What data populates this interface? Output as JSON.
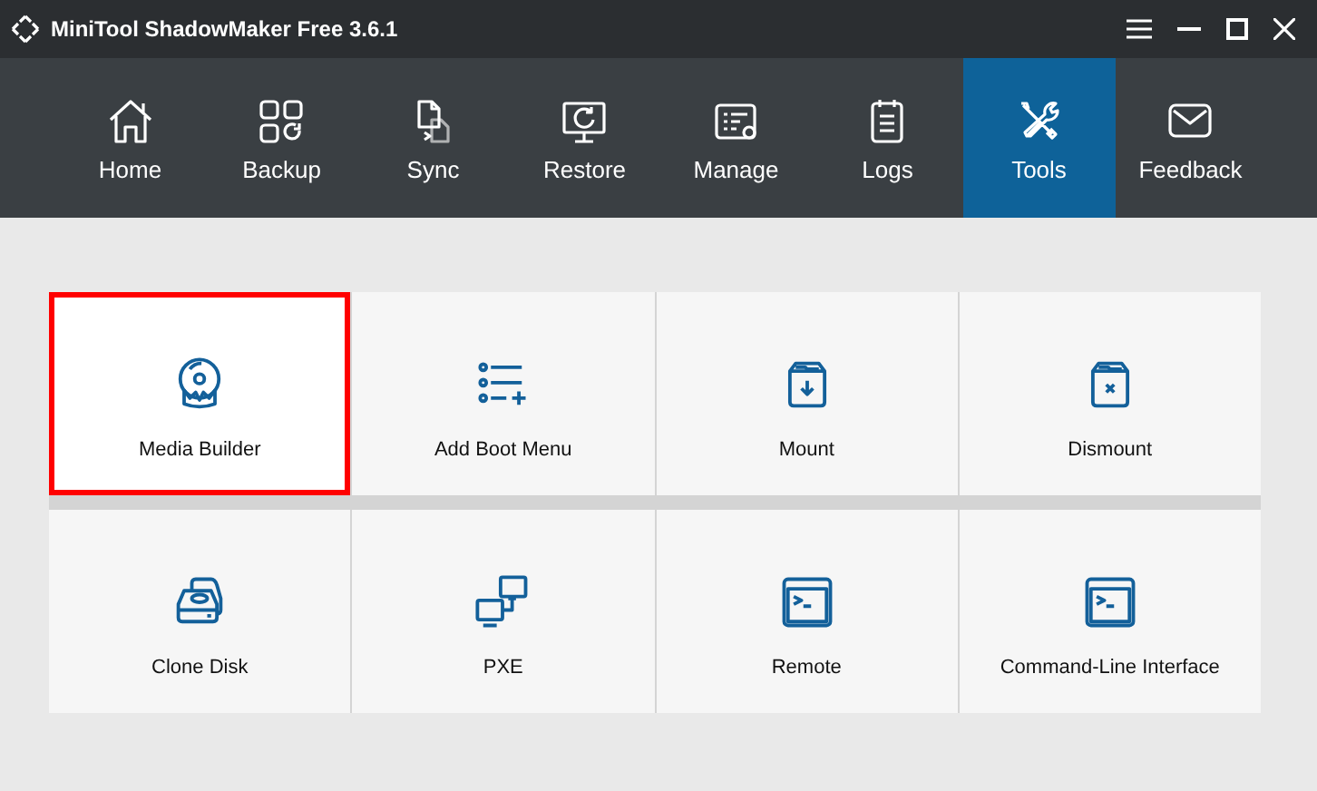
{
  "window": {
    "title": "MiniTool ShadowMaker Free 3.6.1"
  },
  "nav": [
    {
      "label": "Home",
      "selected": false
    },
    {
      "label": "Backup",
      "selected": false
    },
    {
      "label": "Sync",
      "selected": false
    },
    {
      "label": "Restore",
      "selected": false
    },
    {
      "label": "Manage",
      "selected": false
    },
    {
      "label": "Logs",
      "selected": false
    },
    {
      "label": "Tools",
      "selected": true
    },
    {
      "label": "Feedback",
      "selected": false
    }
  ],
  "tools": [
    {
      "label": "Media Builder",
      "selected": true
    },
    {
      "label": "Add Boot Menu",
      "selected": false
    },
    {
      "label": "Mount",
      "selected": false
    },
    {
      "label": "Dismount",
      "selected": false
    },
    {
      "label": "Clone Disk",
      "selected": false
    },
    {
      "label": "PXE",
      "selected": false
    },
    {
      "label": "Remote",
      "selected": false
    },
    {
      "label": "Command-Line Interface",
      "selected": false
    }
  ]
}
